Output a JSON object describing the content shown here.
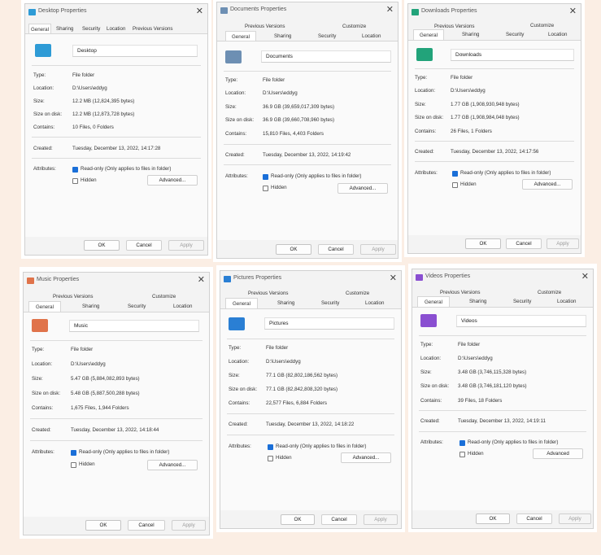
{
  "dialogs": [
    {
      "title": "Desktop Properties",
      "tabs_row1": [],
      "tabs_row2": [
        "General",
        "Sharing",
        "Security",
        "Location",
        "Previous Versions"
      ],
      "active_tab": "General",
      "name": "Desktop",
      "icon_color": "#2e9bd6",
      "rows": [
        {
          "label": "Type:",
          "value": "File folder"
        },
        {
          "label": "Location:",
          "value": "D:\\Users\\eddyg"
        },
        {
          "label": "Size:",
          "value": "12.2 MB (12,824,395 bytes)"
        },
        {
          "label": "Size on disk:",
          "value": "12.2 MB (12,873,728 bytes)"
        },
        {
          "label": "Contains:",
          "value": "10 Files, 0 Folders"
        }
      ],
      "created_label": "Created:",
      "created_value": "Tuesday, December 13, 2022, 14:17:28",
      "attributes_label": "Attributes:",
      "readonly_text": "Read-only (Only applies to files in folder)",
      "hidden_text": "Hidden",
      "advanced": "Advanced...",
      "ok": "OK",
      "cancel": "Cancel",
      "apply": "Apply"
    },
    {
      "title": "Documents Properties",
      "tabs_row1": [
        "Previous Versions",
        "Customize"
      ],
      "tabs_row2": [
        "General",
        "Sharing",
        "Security",
        "Location"
      ],
      "active_tab": "General",
      "name": "Documents",
      "icon_color": "#6d8fb3",
      "rows": [
        {
          "label": "Type:",
          "value": "File folder"
        },
        {
          "label": "Location:",
          "value": "D:\\Users\\eddyg"
        },
        {
          "label": "Size:",
          "value": "36.9 GB (39,659,017,309 bytes)"
        },
        {
          "label": "Size on disk:",
          "value": "36.9 GB (39,660,708,960 bytes)"
        },
        {
          "label": "Contains:",
          "value": "15,810 Files, 4,403 Folders"
        }
      ],
      "created_label": "Created:",
      "created_value": "Tuesday, December 13, 2022, 14:19:42",
      "attributes_label": "Attributes:",
      "readonly_text": "Read-only (Only applies to files in folder)",
      "hidden_text": "Hidden",
      "advanced": "Advanced...",
      "ok": "OK",
      "cancel": "Cancel",
      "apply": "Apply"
    },
    {
      "title": "Downloads Properties",
      "tabs_row1": [
        "Previous Versions",
        "Customize"
      ],
      "tabs_row2": [
        "General",
        "Sharing",
        "Security",
        "Location"
      ],
      "active_tab": "General",
      "name": "Downloads",
      "icon_color": "#22a37a",
      "rows": [
        {
          "label": "Type:",
          "value": "File folder"
        },
        {
          "label": "Location:",
          "value": "D:\\Users\\eddyg"
        },
        {
          "label": "Size:",
          "value": "1.77 GB (1,908,930,948 bytes)"
        },
        {
          "label": "Size on disk:",
          "value": "1.77 GB (1,908,984,048 bytes)"
        },
        {
          "label": "Contains:",
          "value": "26 Files, 1 Folders"
        }
      ],
      "created_label": "Created:",
      "created_value": "Tuesday, December 13, 2022, 14:17:56",
      "attributes_label": "Attributes:",
      "readonly_text": "Read-only (Only applies to files in folder)",
      "hidden_text": "Hidden",
      "advanced": "Advanced...",
      "ok": "OK",
      "cancel": "Cancel",
      "apply": "Apply"
    },
    {
      "title": "Music Properties",
      "tabs_row1": [
        "Previous Versions",
        "Customize"
      ],
      "tabs_row2": [
        "General",
        "Sharing",
        "Security",
        "Location"
      ],
      "active_tab": "General",
      "name": "Music",
      "icon_color": "#e0734a",
      "rows": [
        {
          "label": "Type:",
          "value": "File folder"
        },
        {
          "label": "Location:",
          "value": "D:\\Users\\eddyg"
        },
        {
          "label": "Size:",
          "value": "5.47 GB (5,884,082,893 bytes)"
        },
        {
          "label": "Size on disk:",
          "value": "5.48 GB (5,887,500,288 bytes)"
        },
        {
          "label": "Contains:",
          "value": "1,675 Files, 1,944 Folders"
        }
      ],
      "created_label": "Created:",
      "created_value": "Tuesday, December 13, 2022, 14:18:44",
      "attributes_label": "Attributes:",
      "readonly_text": "Read-only (Only applies to files in folder)",
      "hidden_text": "Hidden",
      "advanced": "Advanced...",
      "ok": "OK",
      "cancel": "Cancel",
      "apply": "Apply"
    },
    {
      "title": "Pictures Properties",
      "tabs_row1": [
        "Previous Versions",
        "Customize"
      ],
      "tabs_row2": [
        "General",
        "Sharing",
        "Security",
        "Location"
      ],
      "active_tab": "General",
      "name": "Pictures",
      "icon_color": "#2a7fd4",
      "rows": [
        {
          "label": "Type:",
          "value": "File folder"
        },
        {
          "label": "Location:",
          "value": "D:\\Users\\eddyg"
        },
        {
          "label": "Size:",
          "value": "77.1 GB (82,802,186,562 bytes)"
        },
        {
          "label": "Size on disk:",
          "value": "77.1 GB (82,842,808,320 bytes)"
        },
        {
          "label": "Contains:",
          "value": "22,577 Files, 6,884 Folders"
        }
      ],
      "created_label": "Created:",
      "created_value": "Tuesday, December 13, 2022, 14:18:22",
      "attributes_label": "Attributes:",
      "readonly_text": "Read-only (Only applies to files in folder)",
      "hidden_text": "Hidden",
      "advanced": "Advanced...",
      "ok": "OK",
      "cancel": "Cancel",
      "apply": "Apply"
    },
    {
      "title": "Videos Properties",
      "tabs_row1": [
        "Previous Versions",
        "Customize"
      ],
      "tabs_row2": [
        "General",
        "Sharing",
        "Security",
        "Location"
      ],
      "active_tab": "General",
      "name": "Videos",
      "icon_color": "#8a4fd1",
      "rows": [
        {
          "label": "Type:",
          "value": "File folder"
        },
        {
          "label": "Location:",
          "value": "D:\\Users\\eddyg"
        },
        {
          "label": "Size:",
          "value": "3.48 GB (3,746,115,328 bytes)"
        },
        {
          "label": "Size on disk:",
          "value": "3.48 GB (3,746,181,120 bytes)"
        },
        {
          "label": "Contains:",
          "value": "39 Files, 18 Folders"
        }
      ],
      "created_label": "Created:",
      "created_value": "Tuesday, December 13, 2022, 14:19:11",
      "attributes_label": "Attributes:",
      "readonly_text": "Read-only (Only applies to files in folder)",
      "hidden_text": "Hidden",
      "advanced": "Advanced",
      "ok": "OK",
      "cancel": "Cancel",
      "apply": "Apply"
    }
  ]
}
